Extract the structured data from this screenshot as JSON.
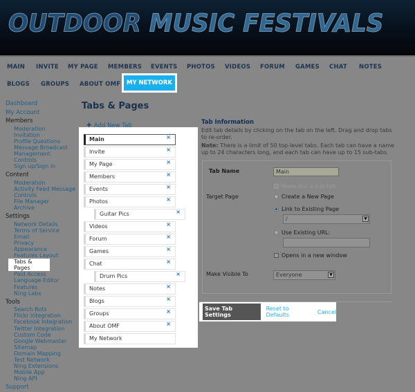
{
  "header": {
    "logo_text_1": "OUTDOOR",
    "logo_text_2": "MUSIC FESTIVALS"
  },
  "nav": {
    "row1": [
      "MAIN",
      "INVITE",
      "MY PAGE",
      "MEMBERS",
      "EVENTS",
      "PHOTOS",
      "VIDEOS",
      "FORUM",
      "GAMES",
      "CHAT",
      "NOTES"
    ],
    "row2": [
      "BLOGS",
      "GROUPS",
      "ABOUT OMF"
    ],
    "active": "MY NETWORK"
  },
  "sidebar": {
    "dashboard": "Dashboard",
    "my_account": "My Account",
    "sections": [
      {
        "title": "Members",
        "items": [
          "Moderation",
          "Invitation",
          "Profile Questions",
          "Message Broadcast",
          "Management",
          "Controls",
          "Sign up/Sign in"
        ]
      },
      {
        "title": "Content",
        "items": [
          "Moderation",
          "Activity Feed Message",
          "Controls",
          "File Manager",
          "Archive"
        ]
      },
      {
        "title": "Settings",
        "items": [
          "Network Details",
          "Terms of Service",
          "Email",
          "Privacy",
          "Appearance",
          "Features Layout",
          "Tabs & Pages",
          "Paid Access",
          "Language Editor",
          "Features",
          "Ning Labs"
        ]
      },
      {
        "title": "Tools",
        "items": [
          "Search Bots",
          "Flickr Integration",
          "Facebook Integration",
          "Twitter Integration",
          "Custom Code",
          "Google Webmaster",
          "Sitemap",
          "Domain Mapping",
          "Test Network",
          "Ning Extensions",
          "Mobile App",
          "Ning API"
        ]
      }
    ],
    "selected": "Tabs & Pages",
    "support": "Support"
  },
  "main": {
    "title": "Tabs & Pages",
    "add_tab": "Add New Tab",
    "tabs": [
      {
        "label": "Main",
        "sub": false,
        "active": true,
        "removable": true
      },
      {
        "label": "Invite",
        "sub": false,
        "removable": true
      },
      {
        "label": "My Page",
        "sub": false,
        "removable": true
      },
      {
        "label": "Members",
        "sub": false,
        "removable": true
      },
      {
        "label": "Events",
        "sub": false,
        "removable": true
      },
      {
        "label": "Photos",
        "sub": false,
        "removable": true
      },
      {
        "label": "Guitar Pics",
        "sub": true,
        "removable": true
      },
      {
        "label": "Videos",
        "sub": false,
        "removable": true
      },
      {
        "label": "Forum",
        "sub": false,
        "removable": true
      },
      {
        "label": "Games",
        "sub": false,
        "removable": true
      },
      {
        "label": "Chat",
        "sub": false,
        "removable": true
      },
      {
        "label": "Drum Pics",
        "sub": true,
        "removable": true
      },
      {
        "label": "Notes",
        "sub": false,
        "removable": true
      },
      {
        "label": "Blogs",
        "sub": false,
        "removable": true
      },
      {
        "label": "Groups",
        "sub": false,
        "removable": true
      },
      {
        "label": "About OMF",
        "sub": false,
        "removable": true
      },
      {
        "label": "My Network",
        "sub": false,
        "removable": false
      }
    ]
  },
  "info": {
    "heading": "Tab Information",
    "desc": "Edit tab details by clicking on the tab on the left. Drag and drop tabs to re-order.",
    "note_label": "Note:",
    "note": " There is a limit of 50 top-level tabs. Each tab can have a name up to 24 characters long, and each tab can have up to 15 sub-tabs.",
    "tab_name_label": "Tab Name",
    "tab_name_value": "Main",
    "subtab_label": "Make this a sub-tab",
    "target_label": "Target Page",
    "opt_new": "Create a New Page",
    "opt_link": "Link to Existing Page",
    "link_value": "/",
    "opt_url": "Use Existing URL:",
    "url_value": "",
    "new_window": "Opens in a new window",
    "visible_label": "Make Visible To",
    "visible_value": "Everyone"
  },
  "actions": {
    "save": "Save Tab Settings",
    "reset": "Reset to Defaults",
    "cancel": "Cancel"
  },
  "colors": {
    "accent": "#1ab0f0",
    "overlay": "#878787"
  }
}
